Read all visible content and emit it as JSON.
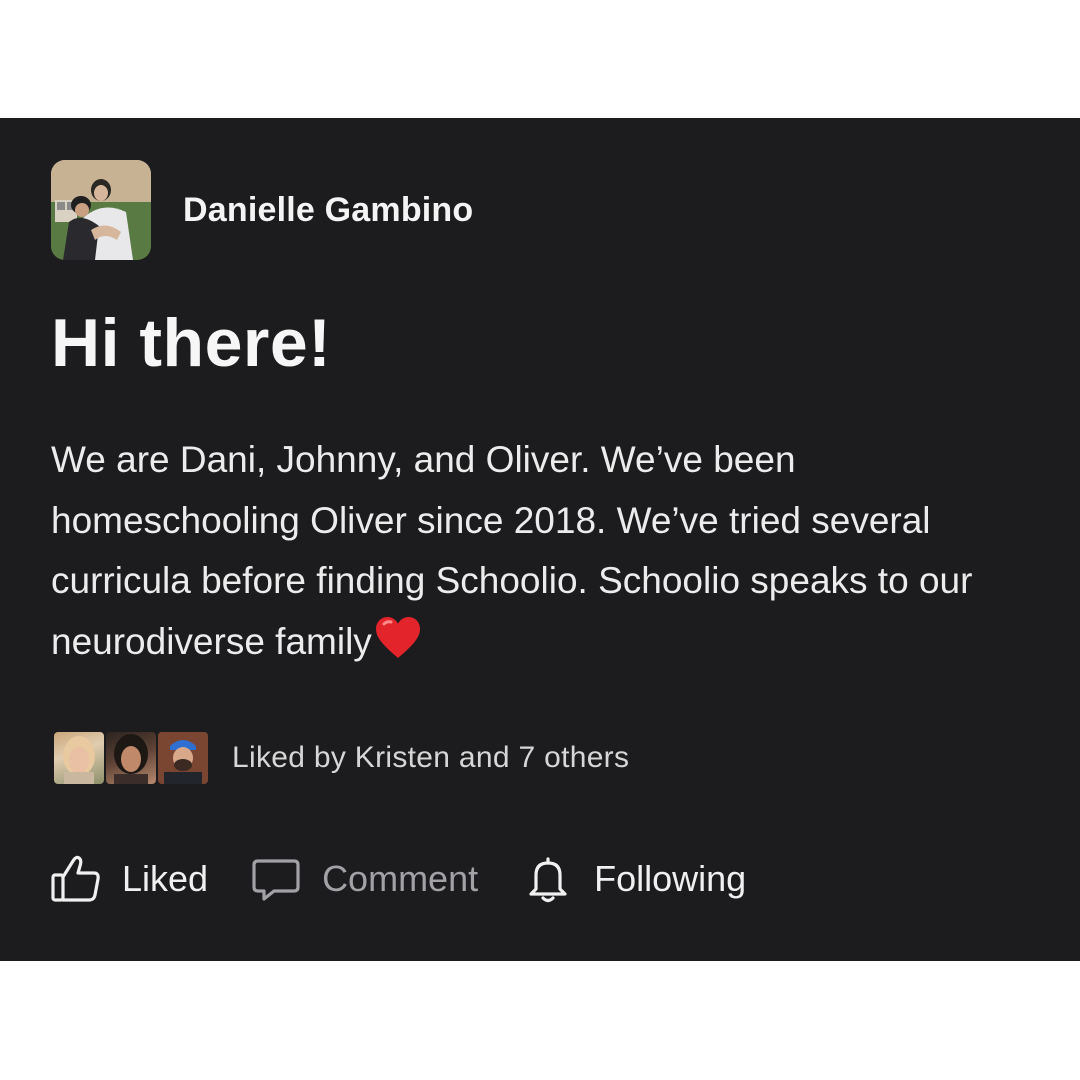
{
  "post": {
    "author": {
      "name": "Danielle Gambino",
      "avatar_icon": "profile-photo"
    },
    "title": "Hi there!",
    "body": "We are Dani, Johnny, and Oliver. We’ve been homeschooling Oliver since 2018. We’ve tried several curricula before finding Schoolio. Schoolio speaks to our neurodiverse family",
    "body_emoji": "heart-emoji"
  },
  "likes": {
    "text": "Liked by Kristen and 7 others",
    "avatars": [
      "liker-photo",
      "liker-photo",
      "liker-photo"
    ]
  },
  "actions": {
    "liked_label": "Liked",
    "comment_label": "Comment",
    "following_label": "Following",
    "liked_icon": "thumbs-up-icon",
    "comment_icon": "speech-bubble-icon",
    "following_icon": "bell-icon"
  },
  "colors": {
    "card_background": "#1c1c1e",
    "primary_text": "#f2f2f2",
    "muted_text": "#a1a1a6",
    "heart": "#e3242b"
  }
}
